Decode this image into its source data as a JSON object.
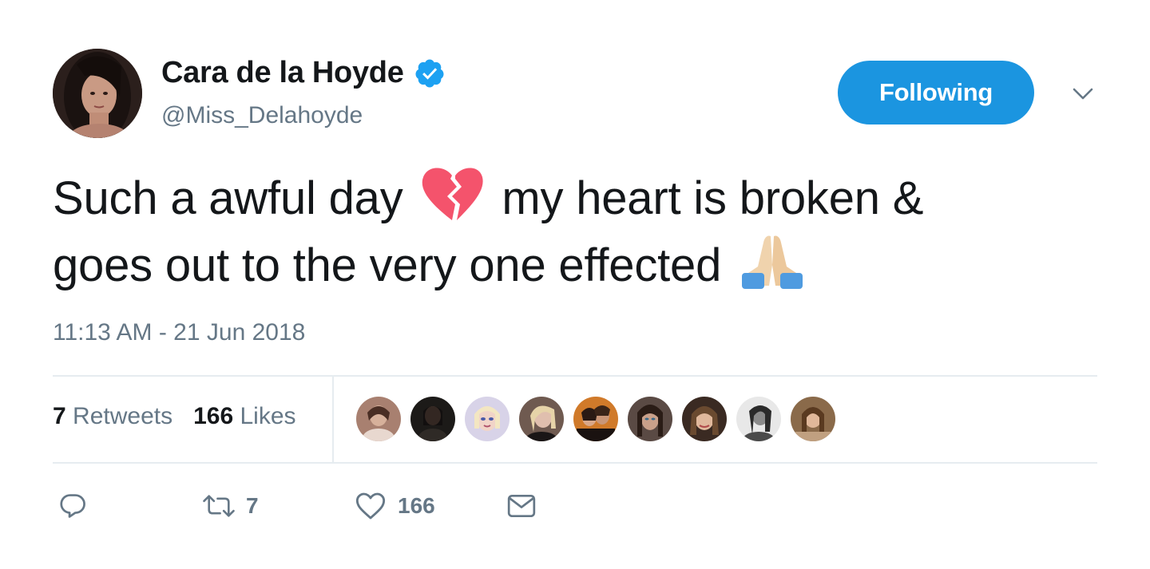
{
  "author": {
    "display_name": "Cara de la Hoyde",
    "handle": "@Miss_Delahoyde",
    "verified_icon": "verified-badge-icon"
  },
  "follow_button": {
    "label": "Following"
  },
  "tweet": {
    "text_line1_part1": "Such a awful day",
    "text_line1_emoji": "broken-heart-emoji",
    "text_line1_part2": "my heart is broken &",
    "text_line2": "goes out to the very one effected",
    "text_line2_emoji": "folded-hands-emoji",
    "timestamp": "11:13 AM - 21 Jun 2018"
  },
  "stats": {
    "retweets_count": "7",
    "retweets_label": "Retweets",
    "likes_count": "166",
    "likes_label": "Likes"
  },
  "likers_count_shown": 9,
  "actions": {
    "reply_icon": "reply-icon",
    "retweet_icon": "retweet-icon",
    "retweet_count": "7",
    "like_icon": "heart-icon",
    "like_count": "166",
    "dm_icon": "envelope-icon"
  },
  "colors": {
    "accent": "#1b95e0",
    "secondary_text": "#657786",
    "divider": "#e6ecf0",
    "broken_heart": "#f4536c"
  }
}
